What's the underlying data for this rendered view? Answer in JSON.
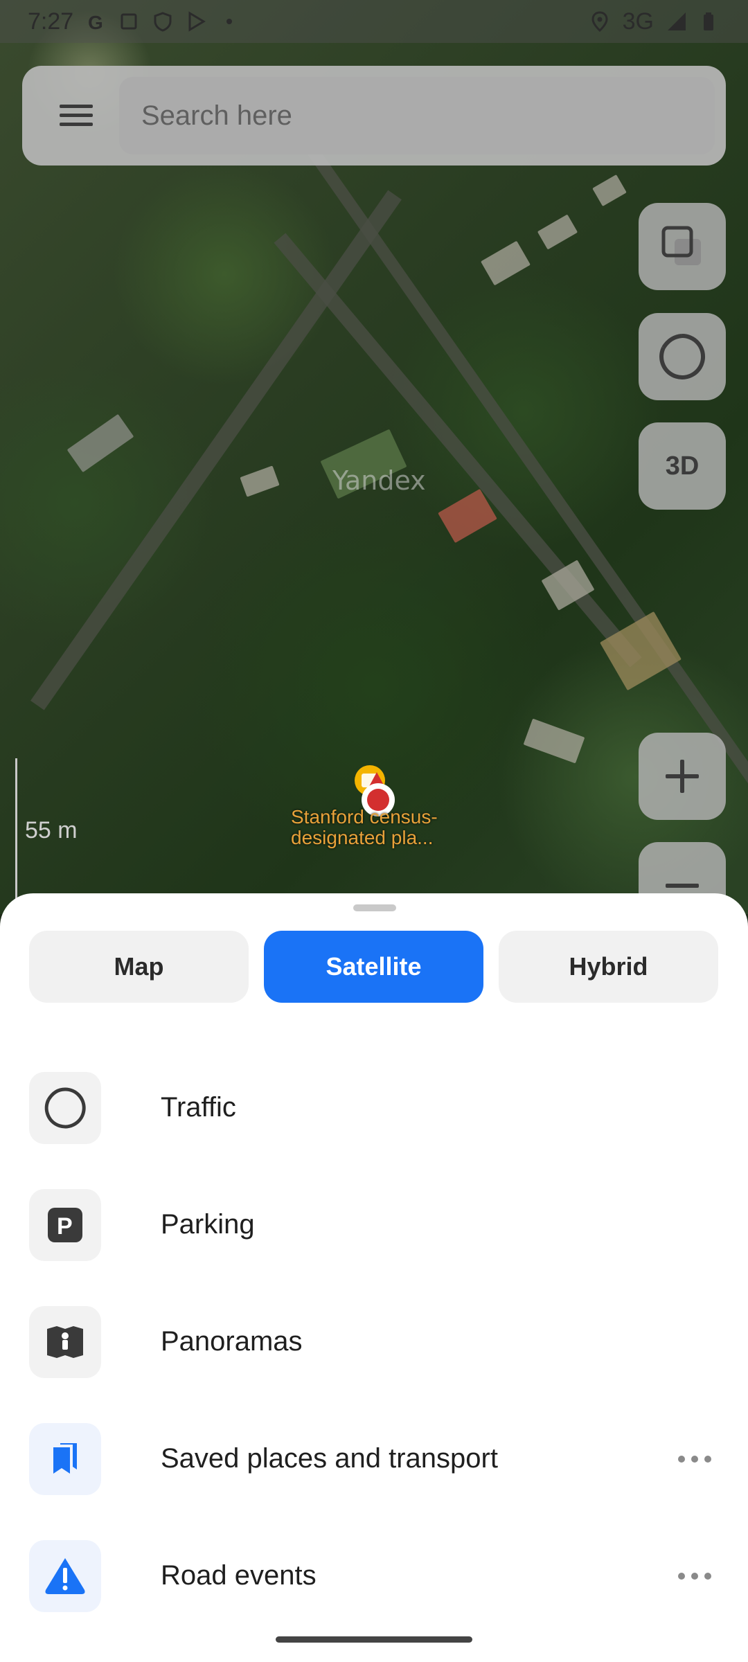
{
  "status_bar": {
    "time": "7:27",
    "network": "3G",
    "left_icons": [
      "google-icon",
      "screenshot-icon",
      "shield-icon",
      "play-store-icon",
      "dot-icon"
    ],
    "right_icons": [
      "location-icon",
      "signal-icon",
      "battery-icon"
    ]
  },
  "search": {
    "placeholder": "Search here"
  },
  "map": {
    "watermark": "Yandex",
    "scale": "55 m",
    "place_label": "Stanford census-designated pla...",
    "controls": {
      "layers_icon": "layers-icon",
      "traffic_icon": "traffic-icon",
      "three_d_label": "3D",
      "zoom_in_icon": "plus-icon",
      "zoom_out_icon": "minus-icon"
    }
  },
  "sheet": {
    "map_types": [
      {
        "label": "Map",
        "active": false
      },
      {
        "label": "Satellite",
        "active": true
      },
      {
        "label": "Hybrid",
        "active": false
      }
    ],
    "layers": [
      {
        "label": "Traffic",
        "icon": "traffic-icon"
      },
      {
        "label": "Parking",
        "icon": "parking-icon"
      },
      {
        "label": "Panoramas",
        "icon": "panoramas-icon"
      },
      {
        "label": "Saved places and transport",
        "icon": "bookmarks-icon"
      },
      {
        "label": "Road events",
        "icon": "warning-icon"
      }
    ]
  },
  "colors": {
    "accent": "#1a73f6",
    "place_label": "#e8a23a",
    "pin_red": "#d32f2f",
    "pin_yellow": "#f4b400"
  }
}
